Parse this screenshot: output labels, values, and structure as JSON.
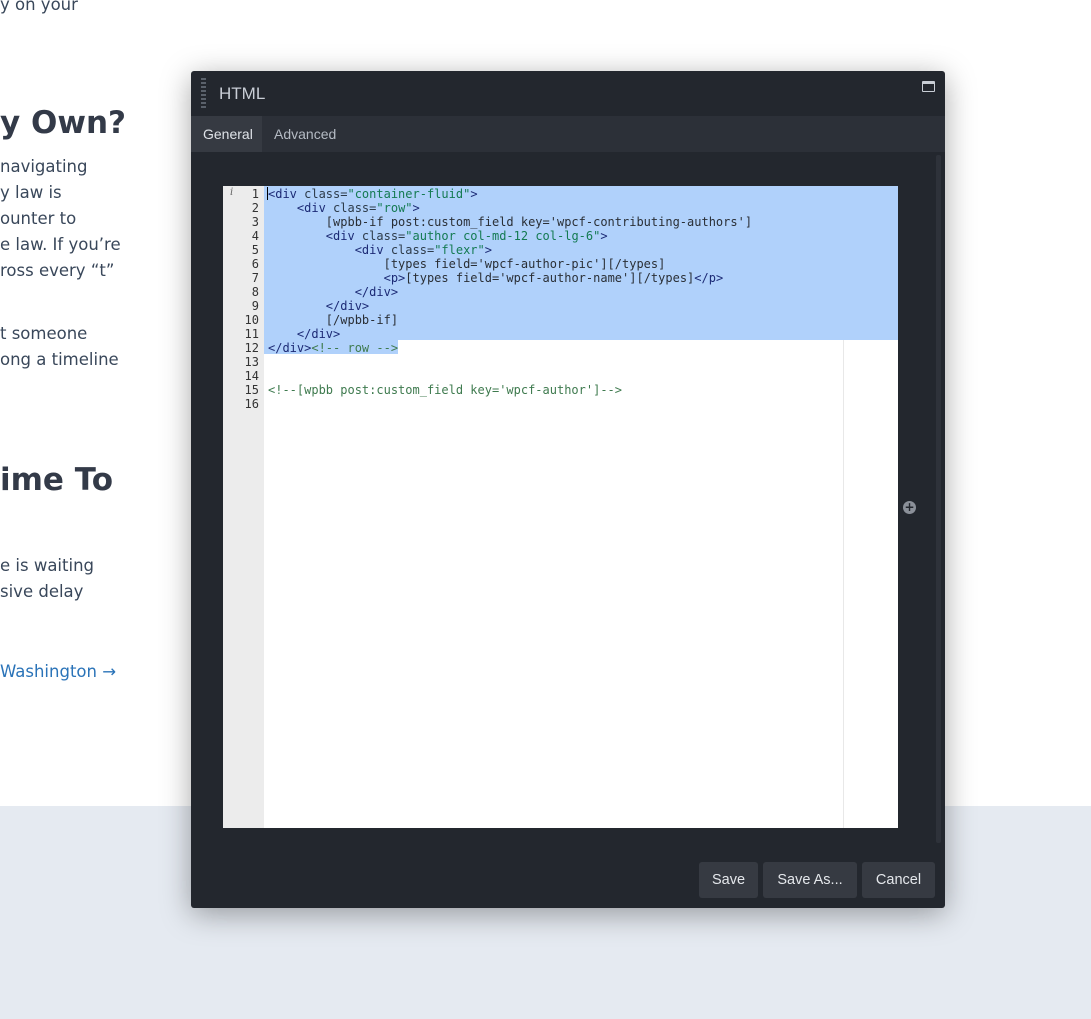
{
  "background": {
    "fragments": [
      "y on your",
      "y Own?",
      "navigating",
      "y law is",
      "ounter to",
      "e law. If you’re",
      "ross every “t”",
      "t someone",
      "ong a timeline",
      "ime To",
      "e is waiting",
      "sive delay",
      "Washington →"
    ]
  },
  "modal": {
    "title": "HTML",
    "tabs": [
      "General",
      "Advanced"
    ],
    "buttons": {
      "save": "Save",
      "save_as": "Save As...",
      "cancel": "Cancel"
    }
  },
  "editor": {
    "lines": [
      {
        "n": "1",
        "parts": [
          [
            "tag",
            "<div "
          ],
          [
            "attr",
            "class="
          ],
          [
            "str",
            "\"container-fluid\""
          ],
          [
            "tag",
            ">"
          ]
        ]
      },
      {
        "n": "2",
        "parts": [
          [
            "txt",
            "    "
          ],
          [
            "tag",
            "<div "
          ],
          [
            "attr",
            "class="
          ],
          [
            "str",
            "\"row\""
          ],
          [
            "tag",
            ">"
          ]
        ]
      },
      {
        "n": "3",
        "parts": [
          [
            "txt",
            "        [wpbb-if post:custom_field key='wpcf-contributing-authors']"
          ]
        ]
      },
      {
        "n": "4",
        "parts": [
          [
            "txt",
            "        "
          ],
          [
            "tag",
            "<div "
          ],
          [
            "attr",
            "class="
          ],
          [
            "str",
            "\"author col-md-12 col-lg-6\""
          ],
          [
            "tag",
            ">"
          ]
        ]
      },
      {
        "n": "5",
        "parts": [
          [
            "txt",
            "            "
          ],
          [
            "tag",
            "<div "
          ],
          [
            "attr",
            "class="
          ],
          [
            "str",
            "\"flexr\""
          ],
          [
            "tag",
            ">"
          ]
        ]
      },
      {
        "n": "6",
        "parts": [
          [
            "txt",
            "                [types field='wpcf-author-pic'][/types]"
          ]
        ]
      },
      {
        "n": "7",
        "parts": [
          [
            "txt",
            "                "
          ],
          [
            "tag",
            "<p>"
          ],
          [
            "txt",
            "[types field='wpcf-author-name'][/types]"
          ],
          [
            "tag",
            "</p>"
          ]
        ]
      },
      {
        "n": "8",
        "parts": [
          [
            "txt",
            "            "
          ],
          [
            "tag",
            "</div>"
          ]
        ]
      },
      {
        "n": "9",
        "parts": [
          [
            "txt",
            "        "
          ],
          [
            "tag",
            "</div>"
          ]
        ]
      },
      {
        "n": "10",
        "parts": [
          [
            "txt",
            "        [/wpbb-if]"
          ]
        ]
      },
      {
        "n": "11",
        "parts": [
          [
            "txt",
            "    "
          ],
          [
            "tag",
            "</div>"
          ]
        ]
      },
      {
        "n": "12",
        "parts": [
          [
            "tag",
            "</div>"
          ],
          [
            "cmt",
            "<!-- row -->"
          ]
        ]
      },
      {
        "n": "13",
        "parts": []
      },
      {
        "n": "14",
        "parts": []
      },
      {
        "n": "15",
        "parts": [
          [
            "cmt",
            "<!--[wpbb post:custom_field key='wpcf-author']-->"
          ]
        ]
      },
      {
        "n": "16",
        "parts": []
      }
    ]
  }
}
